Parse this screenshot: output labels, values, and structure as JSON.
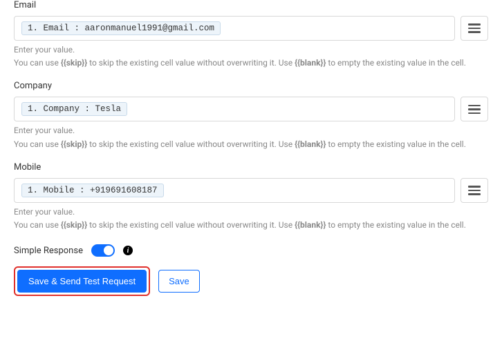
{
  "fields": [
    {
      "label": "Email",
      "token": "1. Email : aaronmanuel1991@gmail.com",
      "help1": "Enter your value.",
      "help2a": "You can use ",
      "help2b": "{{skip}}",
      "help2c": " to skip the existing cell value without overwriting it. Use ",
      "help2d": "{{blank}}",
      "help2e": " to empty the existing value in the cell."
    },
    {
      "label": "Company",
      "token": "1. Company : Tesla",
      "help1": "Enter your value.",
      "help2a": "You can use ",
      "help2b": "{{skip}}",
      "help2c": " to skip the existing cell value without overwriting it. Use ",
      "help2d": "{{blank}}",
      "help2e": " to empty the existing value in the cell."
    },
    {
      "label": "Mobile",
      "token": "1. Mobile : +919691608187",
      "help1": "Enter your value.",
      "help2a": "You can use ",
      "help2b": "{{skip}}",
      "help2c": " to skip the existing cell value without overwriting it. Use ",
      "help2d": "{{blank}}",
      "help2e": " to empty the existing value in the cell."
    }
  ],
  "simpleResponse": {
    "label": "Simple Response",
    "enabled": true
  },
  "buttons": {
    "primary": "Save & Send Test Request",
    "secondary": "Save"
  }
}
